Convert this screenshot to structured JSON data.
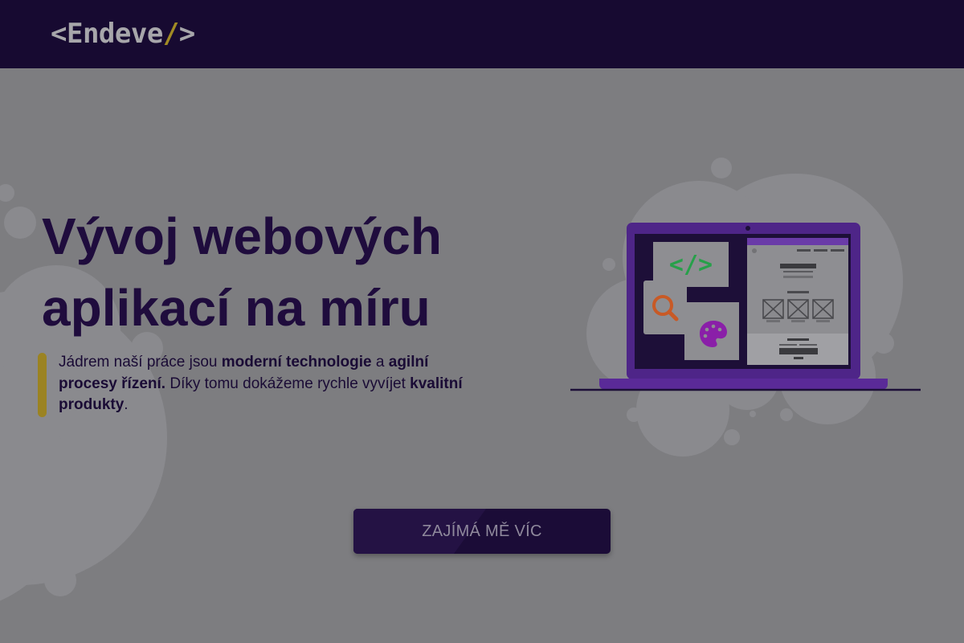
{
  "header": {
    "logo": {
      "open": "<Endeve",
      "slash": "/",
      "close": ">"
    }
  },
  "hero": {
    "title_lines": [
      "Vývoj webových",
      "aplikací na míru"
    ],
    "lead": {
      "p1": "Jádrem naší práce jsou ",
      "b1": "moderní technologie",
      "p2": " a ",
      "b2": "agilní procesy řízení.",
      "p3": " Díky tomu dokážeme rychle vyvíjet ",
      "b3": "kvalitní produkty",
      "p4": "."
    },
    "code_card_text": "</>",
    "cta_label": "ZAJÍMÁ MĚ VÍC"
  },
  "icons": {
    "code": "code-brackets-icon",
    "search": "magnifier-icon",
    "palette": "palette-icon",
    "image": "image-placeholder-icon"
  },
  "colors": {
    "header_bg": "#170a31",
    "page_overlay": "#7d7d80",
    "headline": "#1f0c3d",
    "accent": "#9b8322",
    "laptop": "#5a2a98",
    "code_green": "#27a04a",
    "search_orange": "#c85a26",
    "palette_purple": "#8a1fa8",
    "button_bg": "#1b0c37"
  }
}
